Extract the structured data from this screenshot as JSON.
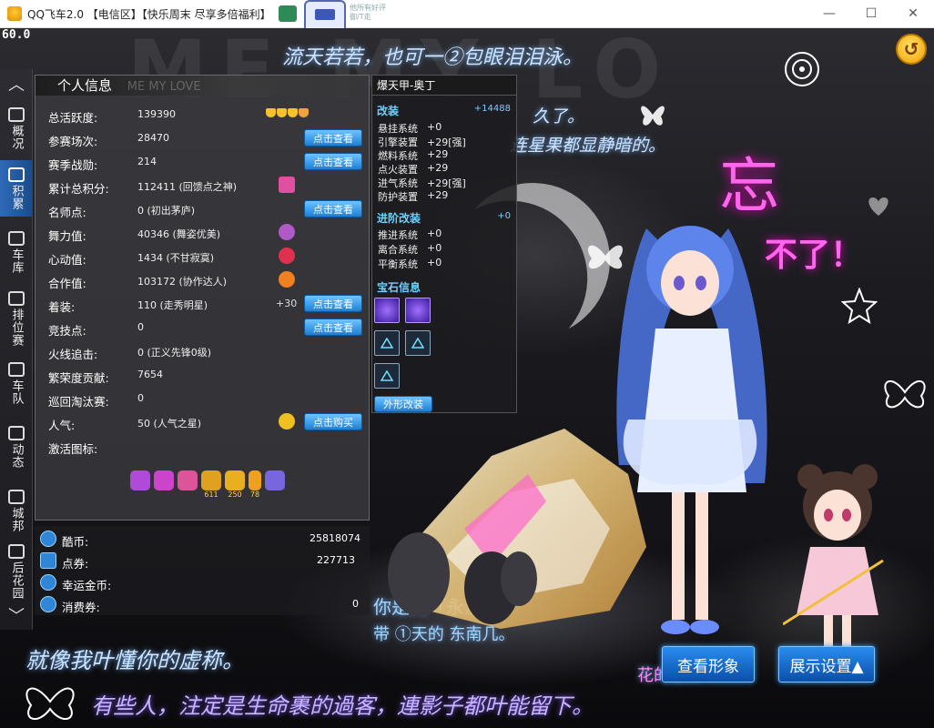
{
  "window": {
    "title": "QQ飞车2.0 【电信区】【快乐周末 尽享多倍福利】",
    "top_note": "他所有好评 御/T走",
    "fps": "60.0"
  },
  "decor": {
    "bg_big": "ME MY LO",
    "top1": "流天若若，也可一②包眼泪泪泳。",
    "top2": "久了。",
    "top3": "连星果都显静暗的。",
    "neon1": "忘",
    "neon2": "不了！",
    "mid1": "你是的「永遥」",
    "mid2": "带 ①天的 东南几。",
    "bottom1": "就像我叶懂你的虚称。",
    "bottom2": "有些人，注定是生命裹的過客，連影子都叶能留下。",
    "right_b": "花的世界"
  },
  "nav": {
    "items": [
      {
        "label": "概况",
        "icon": "profile-card-icon"
      },
      {
        "label": "积累",
        "icon": "layers-icon"
      },
      {
        "label": "车库",
        "icon": "car-icon"
      },
      {
        "label": "排位赛",
        "icon": "rank-badge-icon"
      },
      {
        "label": "车队",
        "icon": "star-icon"
      },
      {
        "label": "动态",
        "icon": "notebook-icon"
      },
      {
        "label": "城邦",
        "icon": "stack-icon"
      },
      {
        "label": "后花园",
        "icon": "garden-icon"
      }
    ]
  },
  "info": {
    "title": "个人信息",
    "header_watermark": "ME MY LOVE",
    "rows": [
      {
        "label": "总活跃度:",
        "value": "139390"
      },
      {
        "label": "参赛场次:",
        "value": "28470",
        "button": "点击查看"
      },
      {
        "label": "赛季战勋:",
        "value": "214",
        "button": "点击查看"
      },
      {
        "label": "累计总积分:",
        "value": "112411 (回馈点之神)"
      },
      {
        "label": "名师点:",
        "value": "0 (初出茅庐)",
        "button": "点击查看"
      },
      {
        "label": "舞力值:",
        "value": "40346 (舞姿优美)"
      },
      {
        "label": "心动值:",
        "value": "1434 (不甘寂寞)"
      },
      {
        "label": "合作值:",
        "value": "103172 (协作达人)"
      },
      {
        "label": "着装:",
        "value": "110 (走秀明星)",
        "extra": "+30",
        "button": "点击查看"
      },
      {
        "label": "竞技点:",
        "value": "0",
        "button": "点击查看"
      },
      {
        "label": "火线追击:",
        "value": "0 (正义先锋0级)"
      },
      {
        "label": "繁荣度贡献:",
        "value": "7654"
      },
      {
        "label": "巡回淘汰赛:",
        "value": "0"
      },
      {
        "label": "人气:",
        "value": "50 (人气之星)",
        "button": "点击购买"
      },
      {
        "label": "激活图标:",
        "value": ""
      }
    ],
    "badges": [
      {
        "icon": "s-badge-icon",
        "color": "#b04ad8",
        "num": ""
      },
      {
        "icon": "bag-badge-icon",
        "color": "#cc44cc",
        "num": ""
      },
      {
        "icon": "gift-badge-icon",
        "color": "#dd5599",
        "num": ""
      },
      {
        "icon": "trophy-badge-icon",
        "color": "#e0a020",
        "num": "611"
      },
      {
        "icon": "medal-badge-icon",
        "color": "#e8b020",
        "num": "250"
      },
      {
        "icon": "card-badge-icon",
        "color": "#f0a020",
        "num": "78"
      },
      {
        "icon": "wing-badge-icon",
        "color": "#7766dd",
        "num": ""
      }
    ]
  },
  "currency": [
    {
      "label": "酷币:",
      "value": "25818074",
      "icon": "coolcoin-icon"
    },
    {
      "label": "点券:",
      "value": "227713",
      "icon": "ticket-icon"
    },
    {
      "label": "幸运金币:",
      "value": "",
      "icon": "lucky-star-icon"
    },
    {
      "label": "消费券:",
      "value": "0",
      "icon": "yen-icon"
    }
  ],
  "car": {
    "title": "爆天甲-奥丁",
    "mod_title": "改装",
    "mod_total": "+14488",
    "mods": [
      {
        "name": "悬挂系统",
        "bonus": "+0"
      },
      {
        "name": "引擎装置",
        "bonus": "+29[强]"
      },
      {
        "name": "燃料系统",
        "bonus": "+29"
      },
      {
        "name": "点火装置",
        "bonus": "+29"
      },
      {
        "name": "进气系统",
        "bonus": "+29[强]"
      },
      {
        "name": "防护装置",
        "bonus": "+29"
      }
    ],
    "adv_title": "进阶改装",
    "adv_total": "+0",
    "adv_mods": [
      {
        "name": "推进系统",
        "bonus": "+0"
      },
      {
        "name": "离合系统",
        "bonus": "+0"
      },
      {
        "name": "平衡系统",
        "bonus": "+0"
      }
    ],
    "gem_title": "宝石信息",
    "appearance_btn": "外形改装"
  },
  "buttons": {
    "view_look": "查看形象",
    "display_settings": "展示设置▲"
  },
  "colors": {
    "accent_blue": "#1d7fd4",
    "section_cyan": "#6fd0ff",
    "neon_pink": "#ff66ee"
  }
}
